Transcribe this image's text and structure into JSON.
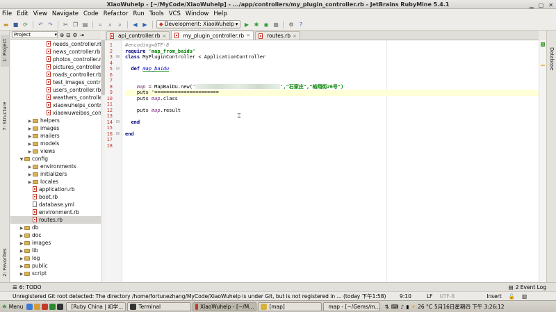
{
  "window": {
    "title": "XiaoWuhelp - [~/MyCode/XiaoWuhelp] - .../app/controllers/my_plugin_controller.rb - JetBrains RubyMine 5.4.1"
  },
  "menu": [
    "File",
    "Edit",
    "View",
    "Navigate",
    "Code",
    "Refactor",
    "Run",
    "Tools",
    "VCS",
    "Window",
    "Help"
  ],
  "toolbar": {
    "run_config": "Development: XiaoWuhelp"
  },
  "left_strip": {
    "project_tab": "1: Project",
    "structure_tab": "7: Structure",
    "favorites_tab": "2: Favorites"
  },
  "project": {
    "header": "Project",
    "tree": [
      {
        "label": "needs_controller.rb",
        "type": "rb"
      },
      {
        "label": "news_controller.rb",
        "type": "rb"
      },
      {
        "label": "photos_controller.rb",
        "type": "rb"
      },
      {
        "label": "pictures_controller.rb",
        "type": "rb"
      },
      {
        "label": "roads_controller.rb",
        "type": "rb"
      },
      {
        "label": "test_images_controller.rb",
        "type": "rb"
      },
      {
        "label": "users_controller.rb",
        "type": "rb"
      },
      {
        "label": "weathers_controller.rb",
        "type": "rb"
      },
      {
        "label": "xiaowuhelps_controller.rb",
        "type": "rb"
      },
      {
        "label": "xiaowuweibos_controller.rb",
        "type": "rb"
      },
      {
        "label": "helpers",
        "type": "folder"
      },
      {
        "label": "images",
        "type": "folder"
      },
      {
        "label": "mailers",
        "type": "folder"
      },
      {
        "label": "models",
        "type": "folder"
      },
      {
        "label": "views",
        "type": "folder"
      },
      {
        "label": "config",
        "type": "folder"
      },
      {
        "label": "environments",
        "type": "folder"
      },
      {
        "label": "initializers",
        "type": "folder"
      },
      {
        "label": "locales",
        "type": "folder"
      },
      {
        "label": "application.rb",
        "type": "rb"
      },
      {
        "label": "boot.rb",
        "type": "rb"
      },
      {
        "label": "database.yml",
        "type": "yml"
      },
      {
        "label": "environment.rb",
        "type": "rb"
      },
      {
        "label": "routes.rb",
        "type": "rb"
      },
      {
        "label": "db",
        "type": "folder"
      },
      {
        "label": "doc",
        "type": "folder"
      },
      {
        "label": "images",
        "type": "folder"
      },
      {
        "label": "lib",
        "type": "folder"
      },
      {
        "label": "log",
        "type": "folder"
      },
      {
        "label": "public",
        "type": "folder"
      },
      {
        "label": "script",
        "type": "folder"
      }
    ]
  },
  "tabs": [
    {
      "label": "api_controller.rb"
    },
    {
      "label": "my_plugin_controller.rb"
    },
    {
      "label": "routes.rb"
    }
  ],
  "editor": {
    "line_numbers": [
      "1",
      "2",
      "3",
      "4",
      "5",
      "6",
      "7",
      "8",
      "9",
      "10",
      "11",
      "12",
      "13",
      "14",
      "15",
      "16",
      "17",
      "18"
    ],
    "code": {
      "l1": "#encoding=UTF-8",
      "l2_kw": "require",
      "l2_str": "'map_from_baidu'",
      "l3_kw": "class",
      "l3_rest": " MyPluginController < ApplicationController",
      "l5_kw": "def",
      "l5_name": "map_baidu",
      "l8_var": "map",
      "l8_rest": " = MapBaiDu.new('",
      "l8_str": "',\"石家庄\",\"裕翔街26号\")",
      "l9": "puts '======================",
      "l10_a": "puts ",
      "l10_var": "map",
      "l10_b": ".class",
      "l12_a": "puts ",
      "l12_var": "map",
      "l12_b": ".result",
      "l14_kw": "end",
      "l16_kw": "end"
    }
  },
  "right_strip": {
    "database_tab": "Database"
  },
  "toolwindows": {
    "todo": "6: TODO",
    "event_log": "2 Event Log"
  },
  "status": {
    "message": "Unregistered Git root detected: The directory /home/fortunezhang/MyCode/XiaoWuhelp is under Git, but is not registered in ... (today 下午1:58)",
    "position": "9:10",
    "line_sep": "LF",
    "encoding": "UTF-8",
    "insert": "Insert"
  },
  "taskbar": {
    "menu": "Menu",
    "tasks": [
      "[Ruby China | 初学...",
      "Terminal",
      "XiaoWuhelp - [~/M...",
      "[map]",
      "map - [~/Gems/m..."
    ],
    "temperature": "26 °C",
    "clock": "5月16日星期四 下午 3:26:12"
  },
  "colors": {
    "curline": "#ffffd7",
    "keyword": "#000080",
    "string": "#008000",
    "comment": "#808080"
  }
}
